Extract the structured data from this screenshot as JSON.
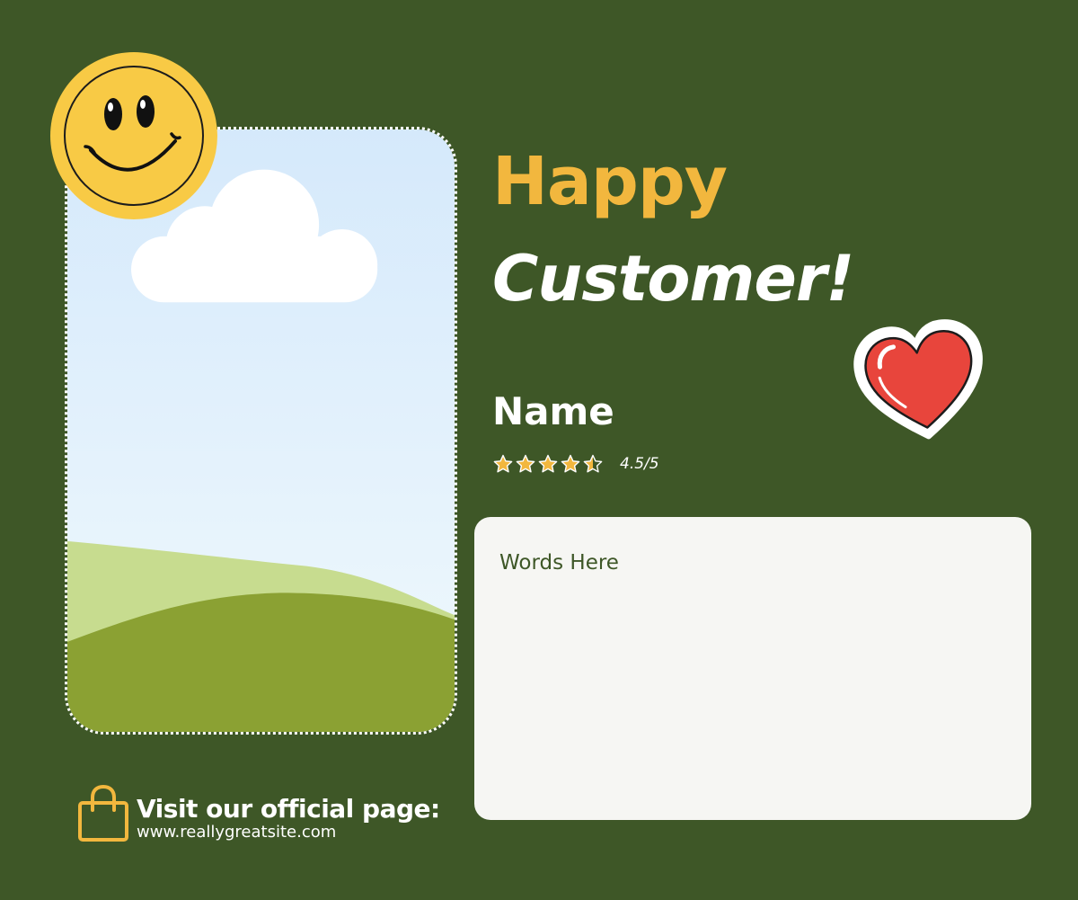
{
  "header": {
    "title_line1": "Happy",
    "title_line2": "Customer!"
  },
  "customer": {
    "name": "Name",
    "rating_value": 4.5,
    "rating_max": 5,
    "rating_text": "4.5/5"
  },
  "review": {
    "text": "Words Here"
  },
  "footer": {
    "cta": "Visit our official page:",
    "url": "www.reallygreatsite.com",
    "icon": "shopping-bag-icon"
  },
  "decorations": {
    "smiley": "smiley-face-icon",
    "heart": "heart-icon",
    "photo": "landscape-illustration"
  },
  "colors": {
    "background": "#3e5727",
    "accent_yellow": "#f2b73e",
    "heart_red": "#e8453c",
    "card": "#f6f6f3",
    "grass_dark": "#8ba133",
    "grass_light": "#c7dc8f",
    "sky_top": "#d5e9fb",
    "sky_bottom": "#edf8fd"
  }
}
